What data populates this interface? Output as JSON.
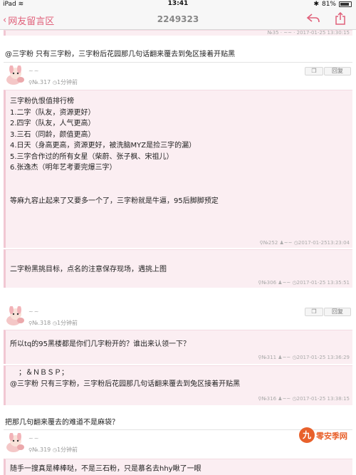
{
  "status": {
    "device": "iPad",
    "wifi": "wifi",
    "time": "13:41",
    "battery": "81%"
  },
  "nav": {
    "back_label": "网友留言区",
    "title": "2249323"
  },
  "top_quote_meta": {
    "floor": "№35",
    "user": "~~",
    "time": "2017-01-25 13:30:15"
  },
  "post1": {
    "text": "@三字粉 只有三字粉，三字粉后花园那几句话翻来覆去到兔区接着开贴黑"
  },
  "post2": {
    "user": "~~",
    "floor": "№.317",
    "ago": "1分钟前",
    "copy_label": "复制",
    "reply_label": "回复",
    "quote1_lines": [
      "三字粉仇恨值排行榜",
      "1.二字（队友，资源更好）",
      "2.四字（队友，人气更高）",
      "3.三石（同龄，颜值更高）",
      "4.日天（身高更高，资源更好，被洗脑MYZ是捡三字的漏）",
      "5.三字合作过的所有女星（柴蔚、张子枫、宋祖儿）",
      "6.张逸杰（明年艺考要完爆三字）",
      "",
      "",
      "等麻九容止起来了又要多一个了，三字粉就是牛逼，95后脚脚预定"
    ],
    "quote1_meta": {
      "floor": "№252",
      "user": "~~",
      "time": "2017-01-2513:23:04"
    },
    "quote2_text": "二字粉黑挑目标，点名的注意保存现场，遇挑上图",
    "quote2_meta": {
      "floor": "№306",
      "user": "~~",
      "time": "2017-01-25 13:35:51"
    }
  },
  "post3": {
    "user": "~~",
    "floor": "№.318",
    "ago": "1分钟前",
    "copy_label": "复制",
    "reply_label": "回复",
    "quote1_text": "所以tq的95黑楼都是你们几字粉开的？谁出来认领一下？",
    "quote1_meta": {
      "floor": "№311",
      "user": "~~",
      "time": "2017-01-25 13:36:29"
    },
    "quote2_line1": "；＆ＮＢＳＰ；",
    "quote2_line2": "@三字粉 只有三字粉，三字粉后花园那几句话翻来覆去到兔区接着开贴黑",
    "quote2_meta": {
      "floor": "№316",
      "user": "~~",
      "time": "2017-01-25 13:38:15"
    },
    "text": "把那几句翻来覆去的难道不是麻袋？"
  },
  "post4": {
    "user": "~~",
    "floor": "№.319",
    "ago": "1分钟前",
    "quote_text": "随手一搜真是棒棒哒，不是三石粉，只是慕名去hhy瞅了一眼"
  },
  "watermark": {
    "badge": "九",
    "text": "零安季网"
  },
  "colors": {
    "accent": "#e0607a",
    "quote_bg": "#fbeef2",
    "quote_border": "#f1c7d3"
  }
}
